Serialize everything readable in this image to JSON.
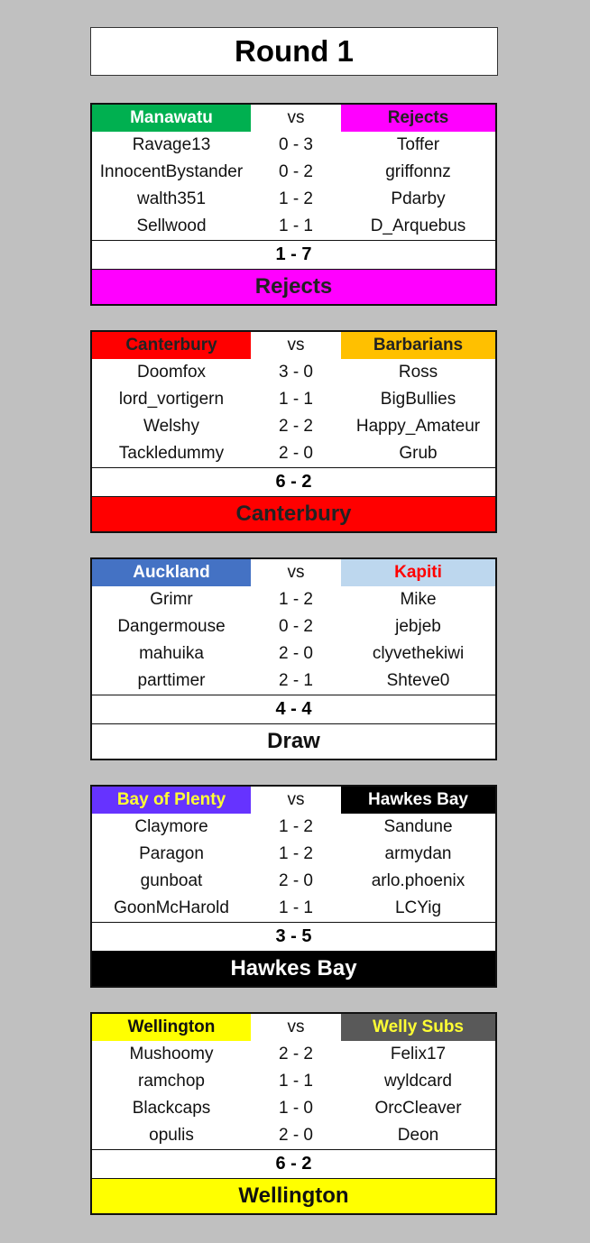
{
  "title": "Round 1",
  "vs": "vs",
  "matches": [
    {
      "home": "Manawatu",
      "home_bg": "#00b050",
      "home_fg": "#ffffff",
      "away": "Rejects",
      "away_bg": "#ff00ff",
      "away_fg": "#222222",
      "games": [
        [
          "Ravage13",
          "0 - 3",
          "Toffer"
        ],
        [
          "InnocentBystander",
          "0 - 2",
          "griffonnz"
        ],
        [
          "walth351",
          "1 - 2",
          "Pdarby"
        ],
        [
          "Sellwood",
          "1 - 1",
          "D_Arquebus"
        ]
      ],
      "total": "1 - 7",
      "winner": "Rejects",
      "winner_bg": "#ff00ff",
      "winner_fg": "#222222"
    },
    {
      "home": "Canterbury",
      "home_bg": "#ff0000",
      "home_fg": "#222222",
      "away": "Barbarians",
      "away_bg": "#ffc000",
      "away_fg": "#222222",
      "games": [
        [
          "Doomfox",
          "3 - 0",
          "Ross"
        ],
        [
          "lord_vortigern",
          "1 - 1",
          "BigBullies"
        ],
        [
          "Welshy",
          "2 - 2",
          "Happy_Amateur"
        ],
        [
          "Tackledummy",
          "2 - 0",
          "Grub"
        ]
      ],
      "total": "6 - 2",
      "winner": "Canterbury",
      "winner_bg": "#ff0000",
      "winner_fg": "#222222"
    },
    {
      "home": "Auckland",
      "home_bg": "#4472c4",
      "home_fg": "#ffffff",
      "away": "Kapiti",
      "away_bg": "#bdd7ee",
      "away_fg": "#ff0000",
      "games": [
        [
          "Grimr",
          "1 - 2",
          "Mike"
        ],
        [
          "Dangermouse",
          "0 - 2",
          "jebjeb"
        ],
        [
          "mahuika",
          "2 - 0",
          "clyvethekiwi"
        ],
        [
          "parttimer",
          "2 - 1",
          "Shteve0"
        ]
      ],
      "total": "4 - 4",
      "winner": "Draw",
      "winner_bg": "#ffffff",
      "winner_fg": "#111111"
    },
    {
      "home": "Bay of Plenty",
      "home_bg": "#6633ff",
      "home_fg": "#ffff33",
      "away": "Hawkes Bay",
      "away_bg": "#000000",
      "away_fg": "#ffffff",
      "games": [
        [
          "Claymore",
          "1 - 2",
          "Sandune"
        ],
        [
          "Paragon",
          "1 - 2",
          "armydan"
        ],
        [
          "gunboat",
          "2 - 0",
          "arlo.phoenix"
        ],
        [
          "GoonMcHarold",
          "1 - 1",
          "LCYig"
        ]
      ],
      "total": "3 - 5",
      "winner": "Hawkes Bay",
      "winner_bg": "#000000",
      "winner_fg": "#ffffff"
    },
    {
      "home": "Wellington",
      "home_bg": "#ffff00",
      "home_fg": "#111111",
      "away": "Welly Subs",
      "away_bg": "#595959",
      "away_fg": "#ffff33",
      "games": [
        [
          "Mushoomy",
          "2 - 2",
          "Felix17"
        ],
        [
          "ramchop",
          "1 - 1",
          "wyldcard"
        ],
        [
          "Blackcaps",
          "1 - 0",
          "OrcCleaver"
        ],
        [
          "opulis",
          "2 - 0",
          "Deon"
        ]
      ],
      "total": "6 - 2",
      "winner": "Wellington",
      "winner_bg": "#ffff00",
      "winner_fg": "#111111"
    }
  ]
}
